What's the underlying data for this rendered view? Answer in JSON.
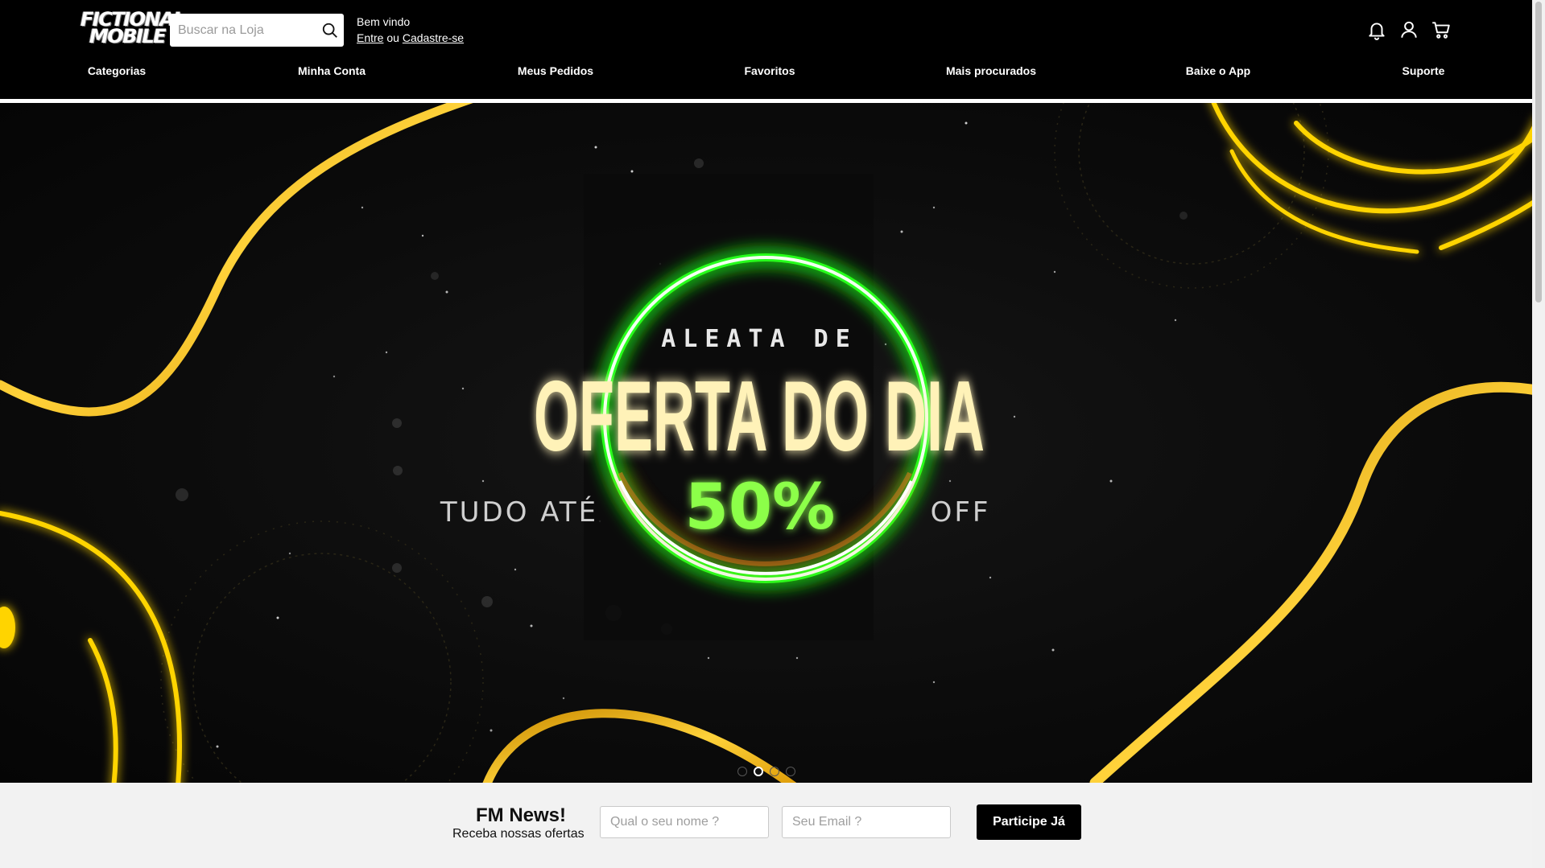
{
  "brand": {
    "logo_line1": "FICTIONAL",
    "logo_line2": "MOBILE"
  },
  "search": {
    "placeholder": "Buscar na Loja",
    "value": ""
  },
  "welcome": {
    "greeting": "Bem vindo",
    "login_link": "Entre",
    "separator": " ou ",
    "signup_link": "Cadastre-se"
  },
  "header_icons": [
    "bell-icon",
    "user-icon",
    "cart-icon"
  ],
  "nav": {
    "items": [
      {
        "label": "Categorias"
      },
      {
        "label": "Minha Conta"
      },
      {
        "label": "Meus Pedidos"
      },
      {
        "label": "Favoritos"
      },
      {
        "label": "Mais procurados"
      },
      {
        "label": "Baixe o App"
      },
      {
        "label": "Suporte"
      }
    ]
  },
  "hero": {
    "eyebrow": "ALEATA DE",
    "headline": "OFERTA DO DIA",
    "prefix": "TUDO ATÉ",
    "discount": "50%",
    "suffix": "OFF",
    "slides_count": 4,
    "active_slide": 2,
    "colors": {
      "gold": "#f5b400",
      "green_ring": "#39ff14",
      "headline": "#fff2b8",
      "discount": "#8cff4a"
    }
  },
  "newsletter": {
    "title": "FM News!",
    "subtitle": "Receba nossas ofertas",
    "name_placeholder": "Qual o seu nome ?",
    "email_placeholder": "Seu Email ?",
    "button_label": "Participe Já"
  }
}
